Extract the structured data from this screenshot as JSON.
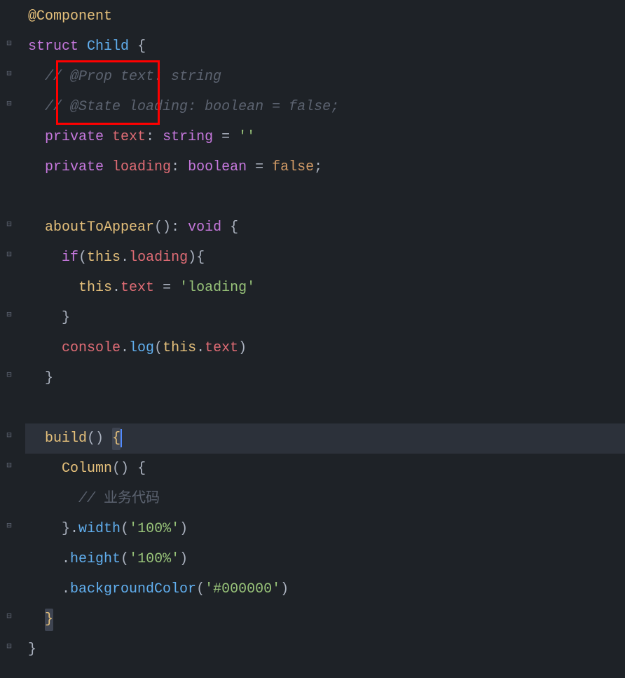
{
  "code": {
    "l1_annotation": "@Component",
    "l2_struct": "struct",
    "l2_name": "Child",
    "l2_brace": "{",
    "l3_comment_a": "// @Prop",
    "l3_comment_b": " text: string",
    "l4_comment_a": "// @State",
    "l4_comment_b": " loading: boolean = false;",
    "l5_private": "private",
    "l5_ident": "text",
    "l5_colon": ":",
    "l5_type": "string",
    "l5_eq": "=",
    "l5_str": "''",
    "l6_private": "private",
    "l6_ident": "loading",
    "l6_colon": ":",
    "l6_type": "boolean",
    "l6_eq": "=",
    "l6_bool": "false",
    "l6_semi": ";",
    "l8_func": "aboutToAppear",
    "l8_paren": "()",
    "l8_colon": ":",
    "l8_void": "void",
    "l8_brace": "{",
    "l9_if": "if",
    "l9_po": "(",
    "l9_this": "this",
    "l9_dot": ".",
    "l9_prop": "loading",
    "l9_pc": ")",
    "l9_brace": "{",
    "l10_this": "this",
    "l10_dot": ".",
    "l10_prop": "text",
    "l10_eq": "=",
    "l10_str": "'loading'",
    "l11_brace": "}",
    "l12_console": "console",
    "l12_dot": ".",
    "l12_log": "log",
    "l12_po": "(",
    "l12_this": "this",
    "l12_dot2": ".",
    "l12_prop": "text",
    "l12_pc": ")",
    "l13_brace": "}",
    "l15_func": "build",
    "l15_paren": "()",
    "l15_brace": "{",
    "l16_col": "Column",
    "l16_paren": "()",
    "l16_brace": "{",
    "l17_comment_slash": "// ",
    "l17_comment_text": "业务代码",
    "l18_brace": "}",
    "l18_dot": ".",
    "l18_width": "width",
    "l18_po": "(",
    "l18_str": "'100%'",
    "l18_pc": ")",
    "l19_dot": ".",
    "l19_height": "height",
    "l19_po": "(",
    "l19_str": "'100%'",
    "l19_pc": ")",
    "l20_dot": ".",
    "l20_bg": "backgroundColor",
    "l20_po": "(",
    "l20_str": "'#000000'",
    "l20_pc": ")",
    "l21_brace": "}",
    "l22_brace": "}"
  }
}
